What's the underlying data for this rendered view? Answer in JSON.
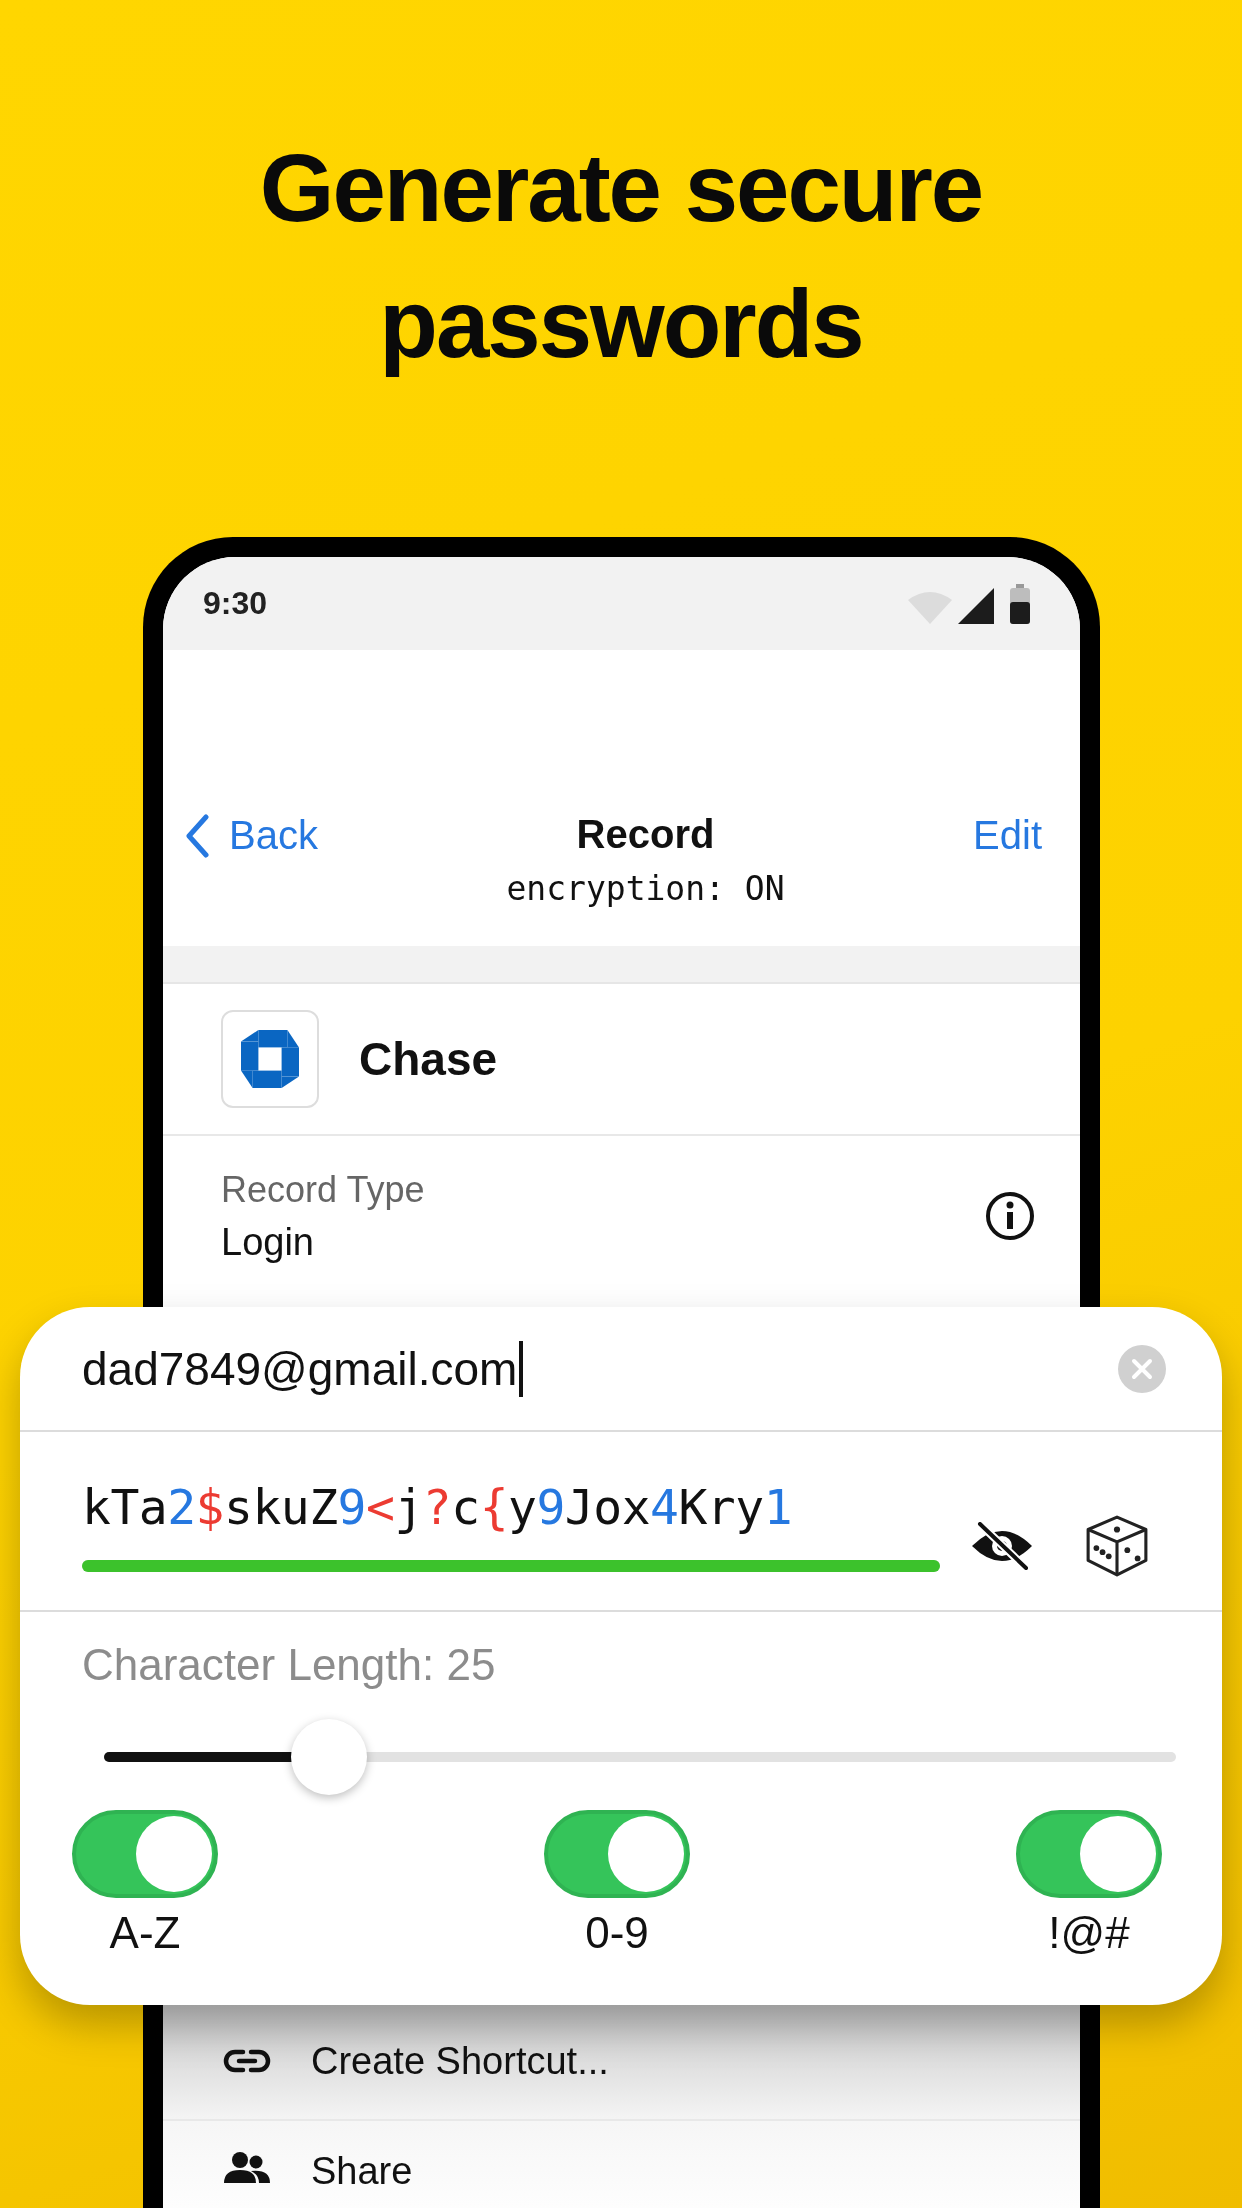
{
  "headline": "Generate secure passwords",
  "status_bar": {
    "time": "9:30"
  },
  "nav": {
    "back": "Back",
    "title": "Record",
    "subtitle": "encryption: ON",
    "action": "Edit"
  },
  "record": {
    "name": "Chase",
    "type_label": "Record Type",
    "type_value": "Login"
  },
  "generator": {
    "username": "dad7849@gmail.com",
    "password": [
      {
        "text": "kTa",
        "kind": "letter"
      },
      {
        "text": "2",
        "kind": "digit"
      },
      {
        "text": "$",
        "kind": "symbol"
      },
      {
        "text": "skuZ",
        "kind": "letter"
      },
      {
        "text": "9",
        "kind": "digit"
      },
      {
        "text": "<",
        "kind": "symbol"
      },
      {
        "text": "j",
        "kind": "letter"
      },
      {
        "text": "?",
        "kind": "symbol"
      },
      {
        "text": "c",
        "kind": "letter"
      },
      {
        "text": "{",
        "kind": "symbol"
      },
      {
        "text": "y",
        "kind": "letter"
      },
      {
        "text": "9",
        "kind": "digit"
      },
      {
        "text": "Jox",
        "kind": "letter"
      },
      {
        "text": "4",
        "kind": "digit"
      },
      {
        "text": "Kry",
        "kind": "letter"
      },
      {
        "text": "1",
        "kind": "digit"
      }
    ],
    "strength": {
      "level": 1
    },
    "length_label": "Character Length: 25",
    "length_slider": {
      "level": 0.21
    },
    "toggles": [
      {
        "label": "A-Z",
        "on": true
      },
      {
        "label": "0-9",
        "on": true
      },
      {
        "label": "!@#",
        "on": true
      }
    ]
  },
  "menu": [
    {
      "label": "Create Shortcut...",
      "kind": "link"
    },
    {
      "label": "Share",
      "kind": "people"
    }
  ]
}
